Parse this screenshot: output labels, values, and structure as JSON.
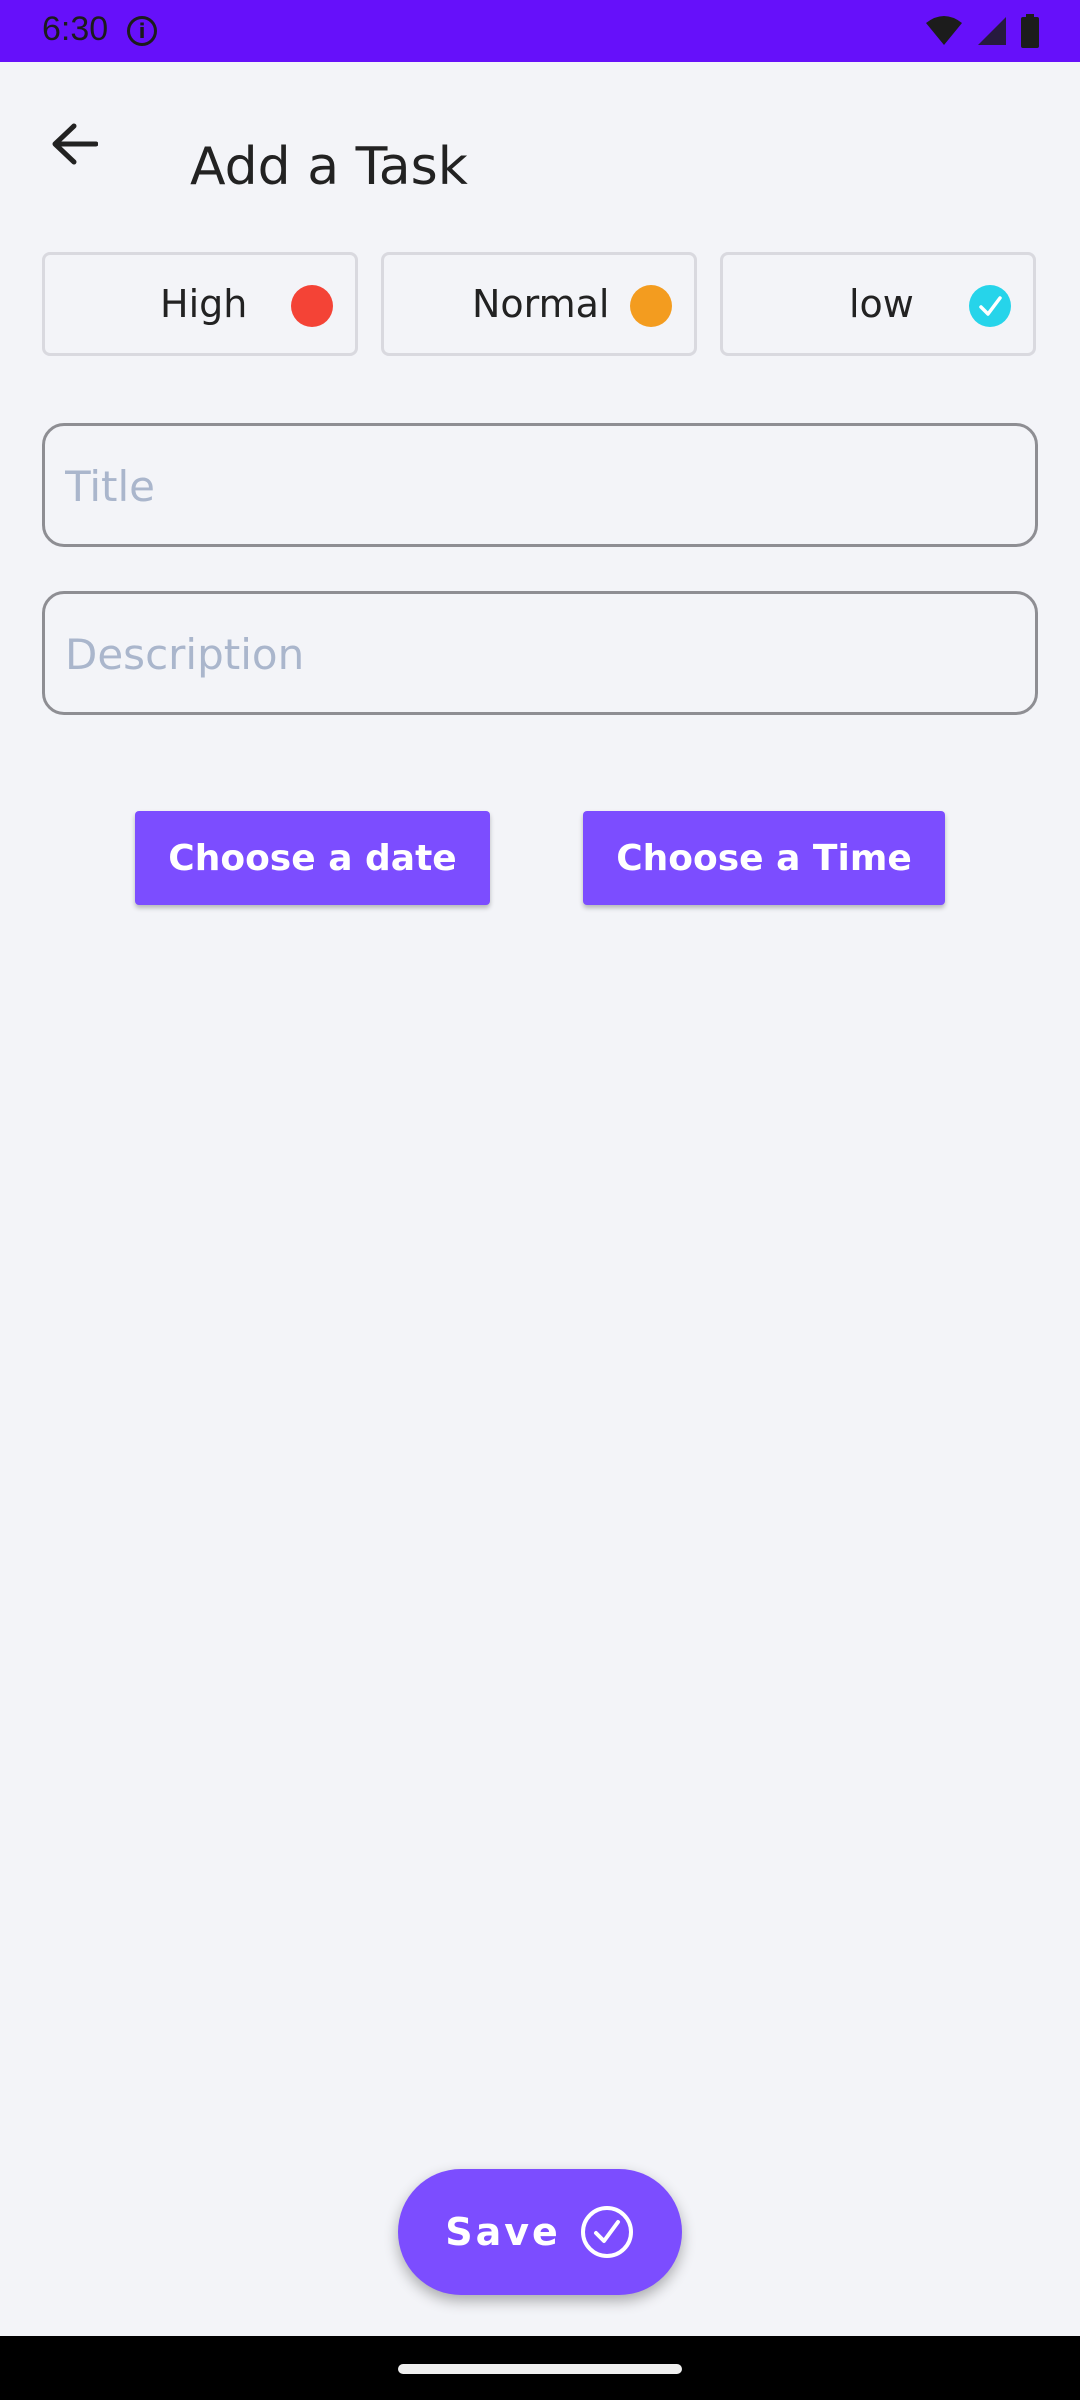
{
  "status_bar": {
    "time": "6:30",
    "background": "#6610fa",
    "icons": [
      "info-icon",
      "wifi-icon",
      "signal-icon",
      "battery-icon"
    ]
  },
  "app_bar": {
    "title": "Add a Task",
    "back_icon": "arrow-left-icon"
  },
  "priorities": [
    {
      "label": "High",
      "color": "#f44336",
      "selected": false
    },
    {
      "label": "Normal",
      "color": "#f39c1f",
      "selected": false
    },
    {
      "label": "low",
      "color": "#26d4ea",
      "selected": true
    }
  ],
  "form": {
    "title_placeholder": "Title",
    "title_value": "",
    "description_placeholder": "Description",
    "description_value": ""
  },
  "buttons": {
    "choose_date": "Choose a date",
    "choose_time": "Choose a Time",
    "save": "Save",
    "accent": "#7c4dff"
  }
}
